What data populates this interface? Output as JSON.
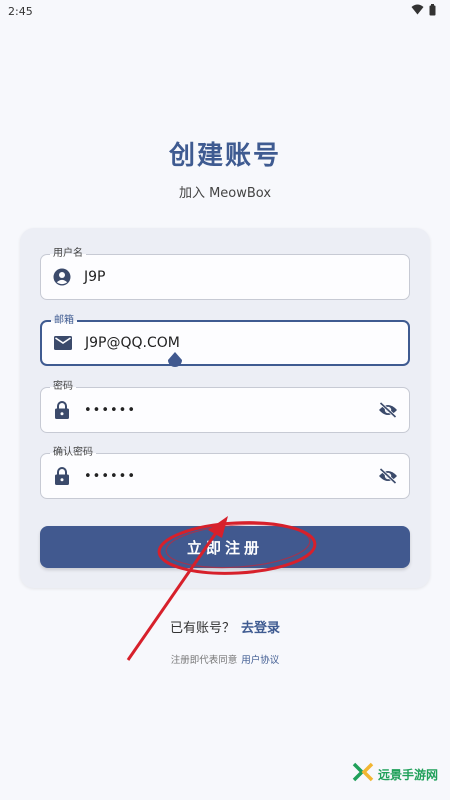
{
  "status_bar": {
    "time": "2:45",
    "icons": [
      "wifi-icon",
      "battery-icon"
    ]
  },
  "header": {
    "title": "创建账号",
    "subtitle": "加入 MeowBox"
  },
  "form": {
    "username": {
      "label": "用户名",
      "value": "J9P",
      "icon": "account-icon"
    },
    "email": {
      "label": "邮箱",
      "value": "J9P@QQ.COM",
      "icon": "mail-icon",
      "focused": true
    },
    "password": {
      "label": "密码",
      "value": "••••••",
      "icon": "lock-icon",
      "toggle_icon": "eye-off-icon"
    },
    "confirm_password": {
      "label": "确认密码",
      "value": "••••••",
      "icon": "lock-icon",
      "toggle_icon": "eye-off-icon"
    },
    "register_label": "立即注册"
  },
  "footer": {
    "have_account": "已有账号？",
    "login_link": "去登录",
    "agree_text": "注册即代表同意",
    "agreement_link": "用户协议"
  },
  "watermark": {
    "text": "远景手游网"
  },
  "colors": {
    "accent": "#41598f",
    "annotation": "#d7202b",
    "card": "#eceef5",
    "background": "#f7f8fc"
  }
}
